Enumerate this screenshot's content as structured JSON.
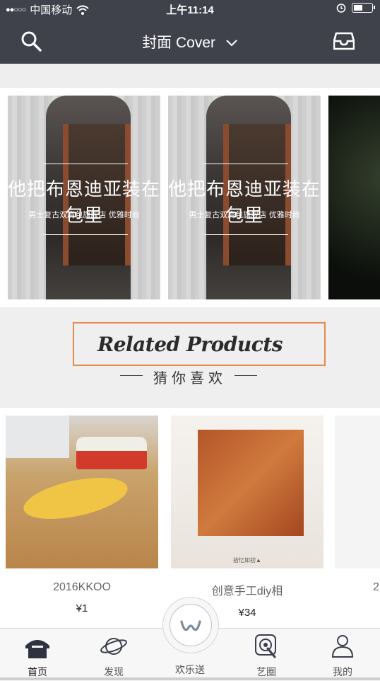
{
  "status_bar": {
    "signal": "●●○○○",
    "carrier": "中国移动",
    "time": "上午11:14"
  },
  "nav": {
    "title": "封面 Cover",
    "search_icon": "search-icon",
    "inbox_icon": "inbox-icon"
  },
  "banners": [
    {
      "headline": "他把布恩迪亚装在包里",
      "sub": "男士复古双肩包旗舰店  优雅时尚"
    },
    {
      "headline": "他把布恩迪亚装在包里",
      "sub": "男士复古双肩包旗舰店  优雅时尚"
    }
  ],
  "related": {
    "heading": "Related Products",
    "subheading": "猜你喜欢"
  },
  "products": [
    {
      "name": "2016KKOO",
      "price": "¥1"
    },
    {
      "name": "创意手工diy相",
      "price": "¥34",
      "caption": "拾忆如初▲"
    },
    {
      "name": "2"
    }
  ],
  "tabs": [
    {
      "label": "首页",
      "icon": "home-icon",
      "active": true
    },
    {
      "label": "发现",
      "icon": "planet-icon"
    },
    {
      "label": "欢乐送",
      "icon": "w-logo-icon"
    },
    {
      "label": "艺圈",
      "icon": "target-icon"
    },
    {
      "label": "我的",
      "icon": "profile-icon"
    }
  ],
  "colors": {
    "nav_bg": "#3f424a",
    "highlight_border": "#e8894a",
    "section_bg": "#efefef"
  }
}
